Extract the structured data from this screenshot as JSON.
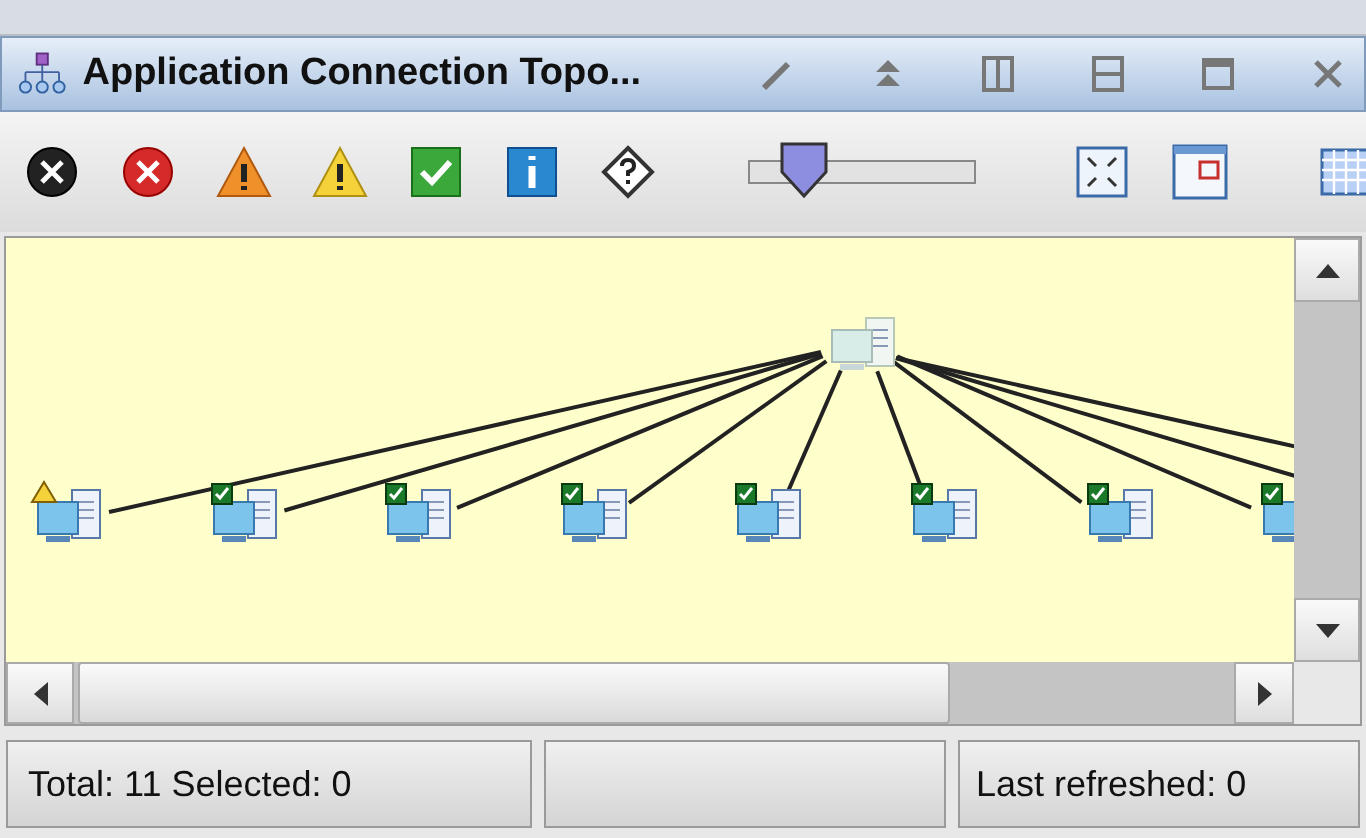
{
  "window": {
    "title": "Application Connection Topo..."
  },
  "zoom_slider": {
    "level": 0.24
  },
  "topology": {
    "nodes": [
      {
        "kind": "warning"
      },
      {
        "kind": "ok"
      },
      {
        "kind": "ok"
      },
      {
        "kind": "ok"
      },
      {
        "kind": "ok"
      },
      {
        "kind": "ok"
      },
      {
        "kind": "ok"
      },
      {
        "kind": "ok"
      }
    ]
  },
  "status_bar": {
    "total": "Total: 11 Selected: 0",
    "refreshed": "Last refreshed: 0"
  }
}
